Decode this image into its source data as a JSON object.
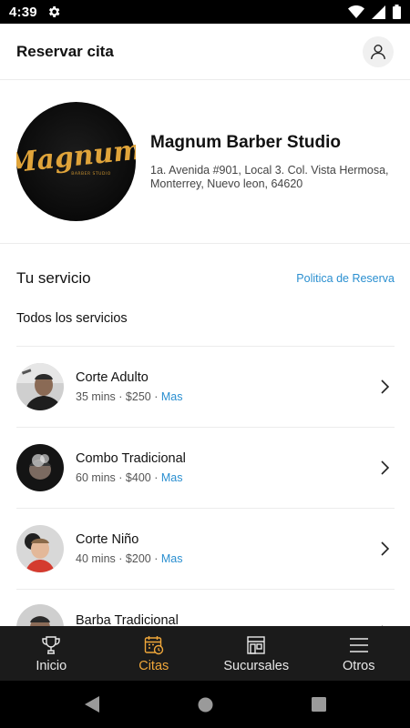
{
  "status_bar": {
    "time": "4:39",
    "icons": [
      "settings-icon",
      "wifi-icon",
      "signal-icon",
      "battery-icon"
    ]
  },
  "header": {
    "title": "Reservar cita",
    "profile_icon": "person-icon"
  },
  "business": {
    "logo_text": "Magnum",
    "logo_subtext": "BARBER STUDIO",
    "name": "Magnum Barber Studio",
    "address": "1a. Avenida #901, Local 3. Col. Vista Hermosa, Monterrey, Nuevo leon, 64620"
  },
  "services_section": {
    "title": "Tu servicio",
    "policy_link": "Politica de Reserva",
    "filter_label": "Todos los servicios",
    "items": [
      {
        "name": "Corte Adulto",
        "duration": "35 mins",
        "price": "$250",
        "more": "Mas"
      },
      {
        "name": "Combo Tradicional",
        "duration": "60 mins",
        "price": "$400",
        "more": "Mas"
      },
      {
        "name": "Corte Niño",
        "duration": "40 mins",
        "price": "$200",
        "more": "Mas"
      },
      {
        "name": "Barba Tradicional",
        "duration": "",
        "price": "",
        "more": ""
      }
    ],
    "separator": "·"
  },
  "bottom_nav": {
    "items": [
      {
        "label": "Inicio",
        "icon": "trophy-icon"
      },
      {
        "label": "Citas",
        "icon": "calendar-clock-icon"
      },
      {
        "label": "Sucursales",
        "icon": "store-icon"
      },
      {
        "label": "Otros",
        "icon": "menu-icon"
      }
    ],
    "active": "Citas"
  },
  "colors": {
    "accent": "#f0a73a",
    "link": "#2a8fd0",
    "nav_background": "#1b1b1b",
    "logo_gold": "#e0a43a"
  }
}
